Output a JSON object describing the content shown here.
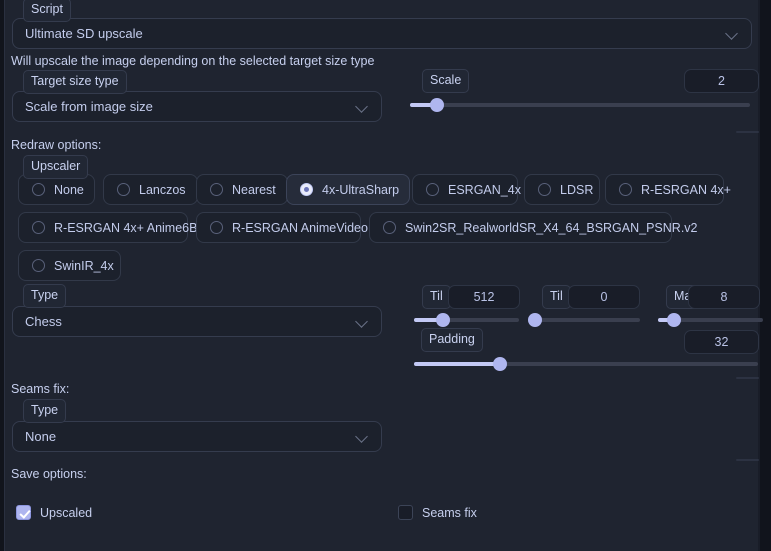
{
  "script": {
    "label": "Script",
    "selected": "Ultimate SD upscale"
  },
  "description": "Will upscale the image depending on the selected target size type",
  "target_size": {
    "label": "Target size type",
    "selected": "Scale from image size"
  },
  "scale": {
    "label": "Scale",
    "value": "2"
  },
  "redraw": {
    "section_label": "Redraw options:",
    "upscaler_label": "Upscaler",
    "upscalers": [
      {
        "label": "None",
        "selected": false
      },
      {
        "label": "Lanczos",
        "selected": false
      },
      {
        "label": "Nearest",
        "selected": false
      },
      {
        "label": "4x-UltraSharp",
        "selected": true
      },
      {
        "label": "ESRGAN_4x",
        "selected": false
      },
      {
        "label": "LDSR",
        "selected": false
      },
      {
        "label": "R-ESRGAN 4x+",
        "selected": false
      },
      {
        "label": "R-ESRGAN 4x+ Anime6B",
        "selected": false
      },
      {
        "label": "R-ESRGAN AnimeVideo",
        "selected": false
      },
      {
        "label": "Swin2SR_RealworldSR_X4_64_BSRGAN_PSNR.v2",
        "selected": false
      },
      {
        "label": "SwinIR_4x",
        "selected": false
      }
    ],
    "type_label": "Type",
    "type_selected": "Chess",
    "tile_width": {
      "label": "Til",
      "value": "512"
    },
    "tile_height": {
      "label": "Til",
      "value": "0"
    },
    "mask_blur": {
      "label": "Ma",
      "value": "8"
    },
    "padding": {
      "label": "Padding",
      "value": "32"
    }
  },
  "seams_fix": {
    "section_label": "Seams fix:",
    "type_label": "Type",
    "type_selected": "None"
  },
  "save_options": {
    "section_label": "Save options:",
    "upscaled": {
      "label": "Upscaled",
      "checked": true
    },
    "seams_fix": {
      "label": "Seams fix",
      "checked": false
    }
  },
  "icons": {
    "chevron": "chevron-down-icon"
  },
  "colors": {
    "background": "#1f2430",
    "field_bg": "#1c212c",
    "accent": "#afb6ef",
    "text": "#c6cfee"
  }
}
